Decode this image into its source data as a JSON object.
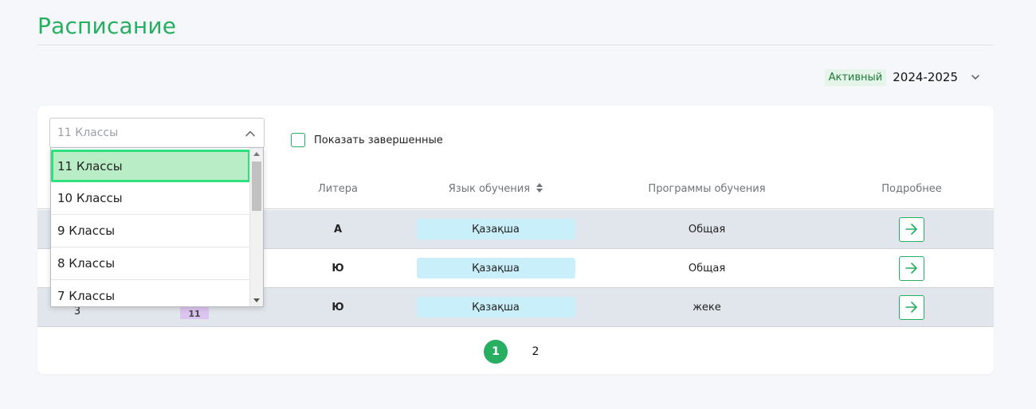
{
  "page": {
    "title": "Расписание"
  },
  "year": {
    "status_badge": "Активный",
    "selected": "2024-2025",
    "chevron_icon": "chevron-down-icon"
  },
  "filter": {
    "select_value": "11 Классы",
    "show_completed_label": "Показать завершенные",
    "show_completed_checked": false
  },
  "dropdown": {
    "options": [
      "11 Классы",
      "10 Классы",
      "9 Классы",
      "8 Классы",
      "7 Классы"
    ],
    "selected_index": 0
  },
  "table": {
    "headers": {
      "litera": "Литера",
      "language": "Язык обучения",
      "program": "Программы обучения",
      "details": "Подробнее"
    },
    "rows": [
      {
        "number": "",
        "class_tag": "",
        "litera": "А",
        "language": "Қазақша",
        "program": "Общая"
      },
      {
        "number": "",
        "class_tag": "",
        "litera": "Ю",
        "language": "Қазақша",
        "program": "Общая"
      },
      {
        "number": "3",
        "class_tag": "11",
        "litera": "Ю",
        "language": "Қазақша",
        "program": "жеке"
      }
    ]
  },
  "pagination": {
    "pages": [
      "1",
      "2"
    ],
    "current": "1"
  },
  "colors": {
    "accent": "#27ae60",
    "language_pill": "#c9f0fa",
    "alt_row": "#e1e6ec",
    "dropdown_selected": "#b8edc6"
  }
}
